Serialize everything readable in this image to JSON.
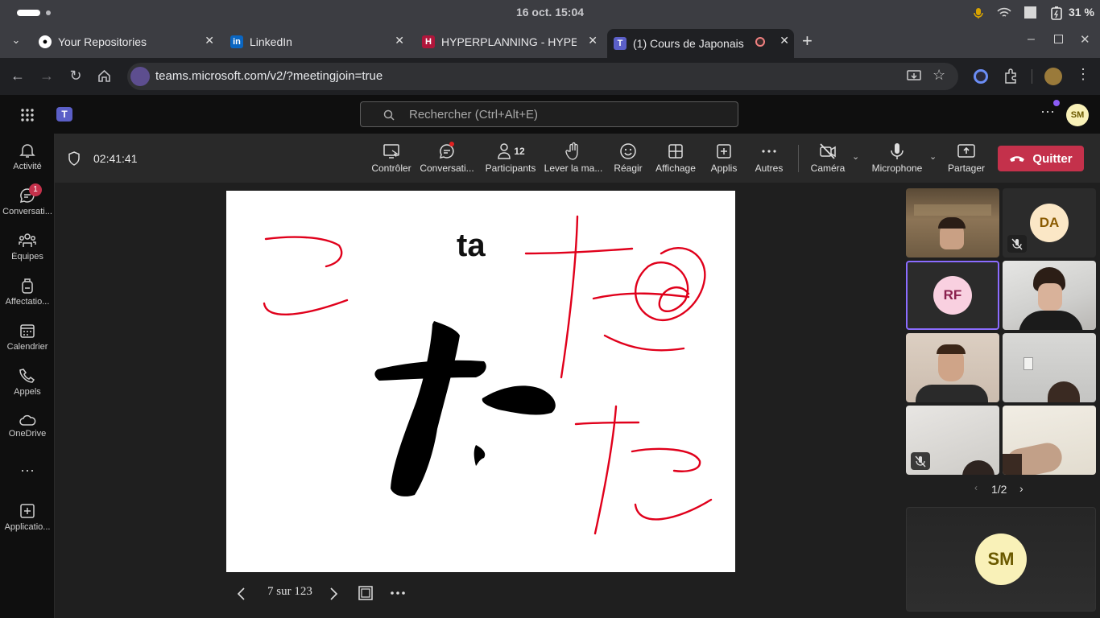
{
  "os": {
    "date_time": "16 oct.  15:04",
    "battery": "31 %"
  },
  "tabs": [
    {
      "title": "Your Repositories",
      "favicon": "github-icon"
    },
    {
      "title": "LinkedIn",
      "favicon": "linkedin-icon"
    },
    {
      "title": "HYPERPLANNING - HYPERPL",
      "favicon": "hyperplanning-icon",
      "favicon_letter": "H"
    },
    {
      "title": "(1) Cours de Japonais",
      "favicon": "teams-icon",
      "active": true,
      "recording": true
    }
  ],
  "browser": {
    "url": "teams.microsoft.com/v2/?meetingjoin=true"
  },
  "teams": {
    "search_placeholder": "Rechercher (Ctrl+Alt+E)",
    "user_initials": "SM",
    "brand_color": "#7b83eb"
  },
  "rail": [
    {
      "label": "Activité",
      "icon": "bell-icon"
    },
    {
      "label": "Conversati...",
      "icon": "chat-icon",
      "badge": "1"
    },
    {
      "label": "Équipes",
      "icon": "teams-group-icon"
    },
    {
      "label": "Affectatio...",
      "icon": "backpack-icon"
    },
    {
      "label": "Calendrier",
      "icon": "calendar-icon"
    },
    {
      "label": "Appels",
      "icon": "phone-icon"
    },
    {
      "label": "OneDrive",
      "icon": "cloud-icon"
    },
    {
      "label": "",
      "icon": "more-icon"
    },
    {
      "label": "Applicatio...",
      "icon": "add-app-icon"
    }
  ],
  "meeting": {
    "timer": "02:41:41",
    "controls": [
      {
        "label": "Contrôler",
        "icon": "control-icon"
      },
      {
        "label": "Conversati...",
        "icon": "chat-icon"
      },
      {
        "label": "Participants",
        "icon": "person-icon",
        "count": "12"
      },
      {
        "label": "Lever la ma...",
        "icon": "hand-icon"
      },
      {
        "label": "Réagir",
        "icon": "smile-icon"
      },
      {
        "label": "Affichage",
        "icon": "grid-icon"
      },
      {
        "label": "Applis",
        "icon": "add-box-icon"
      },
      {
        "label": "Autres",
        "icon": "more-icon"
      },
      {
        "label": "Caméra",
        "icon": "camera-off-icon"
      },
      {
        "label": "Microphone",
        "icon": "mic-icon"
      },
      {
        "label": "Partager",
        "icon": "share-icon"
      }
    ],
    "quit_label": "Quitter",
    "quit_color": "#c4314b"
  },
  "slide": {
    "title_text": "ta",
    "page_indicator": "7 sur 123",
    "ink_color": "#e0001b"
  },
  "gallery": {
    "tiles": [
      {
        "type": "video",
        "name": "participant-1"
      },
      {
        "type": "avatar",
        "initials": "DA",
        "avatar_bg": "#fbe7c6",
        "avatar_fg": "#8a5a00",
        "muted": true
      },
      {
        "type": "avatar",
        "initials": "RF",
        "avatar_bg": "#f9d0e0",
        "avatar_fg": "#8a1f4d",
        "speaking": true
      },
      {
        "type": "video",
        "name": "participant-4"
      },
      {
        "type": "video",
        "name": "participant-5"
      },
      {
        "type": "video",
        "name": "participant-6"
      },
      {
        "type": "video",
        "name": "participant-7",
        "muted": true
      },
      {
        "type": "video",
        "name": "participant-8"
      }
    ],
    "page": "1/2",
    "self_initials": "SM",
    "self_avatar_bg": "#f9f1b8",
    "self_avatar_fg": "#6b5a00"
  }
}
